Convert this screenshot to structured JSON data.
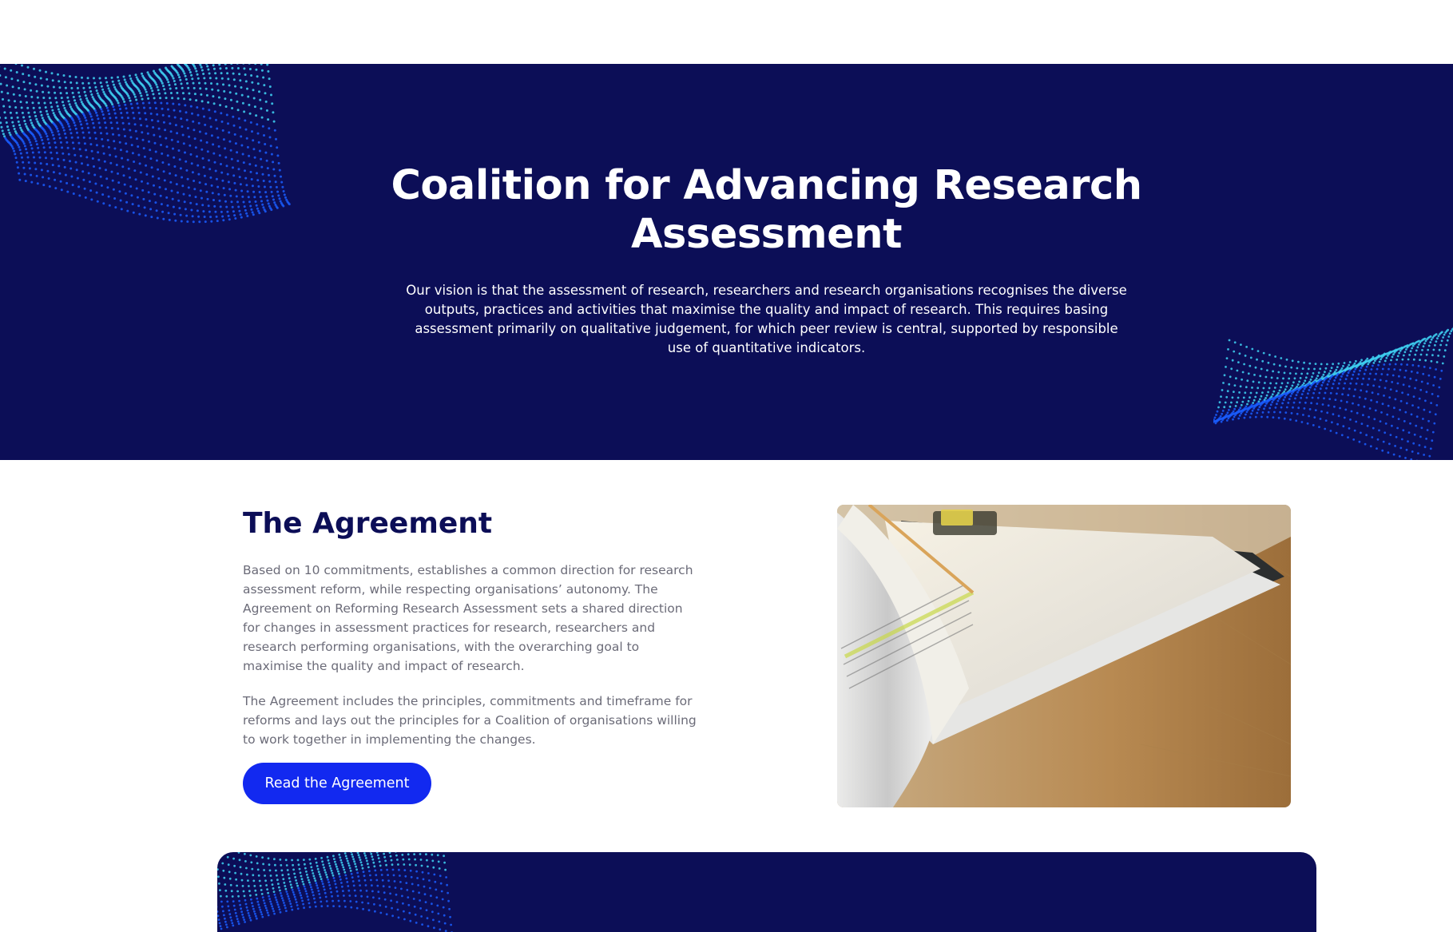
{
  "hero": {
    "title_line1": "Coalition for Advancing Research",
    "title_line2": "Assessment",
    "vision": "Our vision is that the assessment of research, researchers and research organisations recognises the diverse outputs, practices and activities that maximise the quality and impact of research. This requires basing assessment primarily on qualitative judgement, for which peer review is central, supported by responsible use of quantitative indicators."
  },
  "agreement": {
    "title": "The Agreement",
    "paragraph1": "Based on 10 commitments, establishes a common direction for research assessment reform, while respecting organisations’ autonomy. The Agreement on Reforming Research Assessment sets a shared direction for changes in assessment practices for research, researchers and research performing organisations, with the overarching goal to maximise the quality and impact of research.",
    "paragraph2": "The Agreement includes the principles, commitments and timeframe for reforms and lays out the principles for a Coalition of organisations willing to work together in implementing the changes.",
    "button_label": "Read the Agreement"
  },
  "colors": {
    "navy": "#0c0e57",
    "accent_blue": "#1229f0",
    "dot_cyan": "#3fd3f5",
    "dot_blue": "#1a5dff"
  }
}
